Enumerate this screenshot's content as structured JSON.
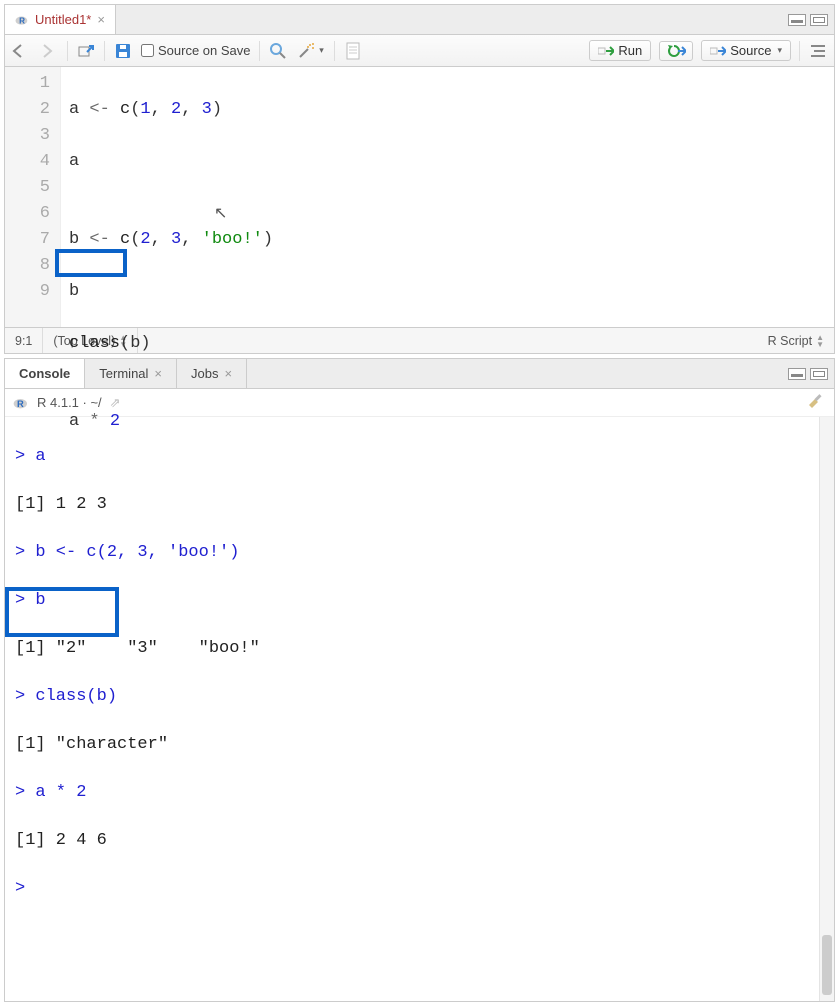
{
  "editor": {
    "tab_title": "Untitled1*",
    "source_on_save_label": "Source on Save",
    "run_label": "Run",
    "source_label": "Source",
    "lines": {
      "l1": {
        "num": "1",
        "a": "a ",
        "op": "<-",
        "sp": " ",
        "fn": "c",
        "open": "(",
        "n1": "1",
        "c1": ", ",
        "n2": "2",
        "c2": ", ",
        "n3": "3",
        "close": ")"
      },
      "l2": {
        "num": "2",
        "code": "a"
      },
      "l3": {
        "num": "3",
        "code": ""
      },
      "l4": {
        "num": "4",
        "a": "b ",
        "op": "<-",
        "sp": " ",
        "fn": "c",
        "open": "(",
        "n1": "2",
        "c1": ", ",
        "n2": "3",
        "c2": ", ",
        "str": "'boo!'",
        "close": ")"
      },
      "l5": {
        "num": "5",
        "code": "b"
      },
      "l6": {
        "num": "6",
        "fn": "class",
        "open": "(",
        "arg": "b",
        "close": ")"
      },
      "l7": {
        "num": "7",
        "code": ""
      },
      "l8": {
        "num": "8",
        "a": "a ",
        "op": "*",
        "sp": " ",
        "n": "2"
      },
      "l9": {
        "num": "9",
        "code": ""
      }
    },
    "status": {
      "cursor_pos": "9:1",
      "scope": "(Top Level)",
      "lang": "R Script"
    }
  },
  "console": {
    "tabs": {
      "console": "Console",
      "terminal": "Terminal",
      "jobs": "Jobs"
    },
    "meta": "R 4.1.1 · ~/",
    "lines": {
      "p_a": "> a",
      "o_a": "[1] 1 2 3",
      "p_b_assign": "> b <- c(2, 3, 'boo!')",
      "p_b": "> b",
      "o_b": "[1] \"2\"    \"3\"    \"boo!\"",
      "p_class": "> class(b)",
      "o_class": "[1] \"character\"",
      "p_amul": "> a * 2",
      "o_amul": "[1] 2 4 6",
      "p_blank": ">"
    }
  }
}
